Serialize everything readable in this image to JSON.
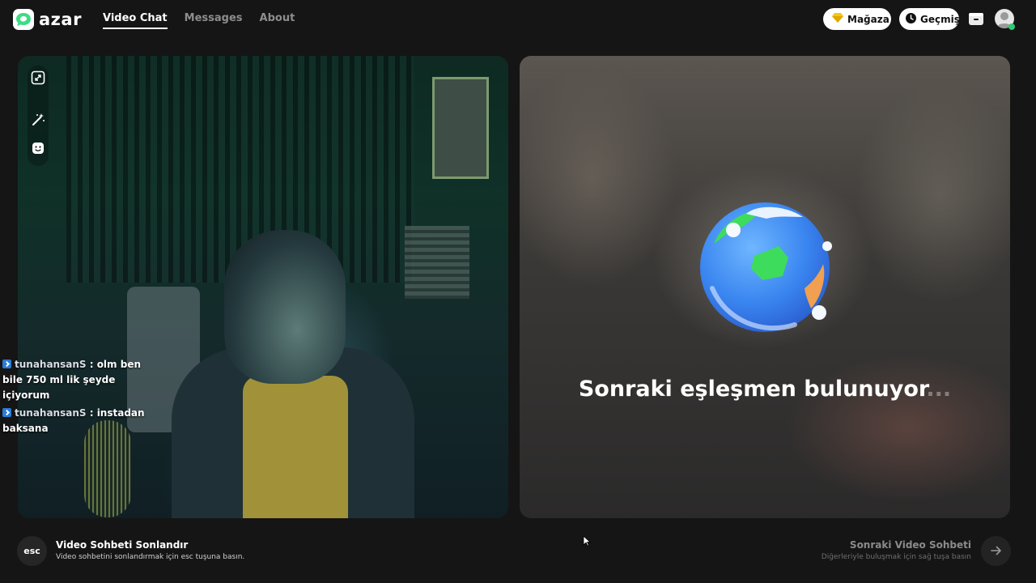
{
  "brand": {
    "name": "azar",
    "logo_icon": "azar-logo-icon"
  },
  "nav": {
    "items": [
      {
        "label": "Video Chat",
        "active": true
      },
      {
        "label": "Messages",
        "active": false
      },
      {
        "label": "About",
        "active": false
      }
    ]
  },
  "header": {
    "shop_label": "Mağaza",
    "shop_icon": "gem-icon",
    "history_label": "Geçmiş",
    "history_icon": "clock-icon",
    "inbox_icon": "inbox-icon",
    "avatar_icon": "user-avatar-icon",
    "avatar_badge_color": "#2ecc71"
  },
  "left_video": {
    "tools": [
      "expand-icon",
      "magic-wand-icon",
      "face-effects-icon"
    ],
    "chat": [
      {
        "user": "tunahansanS",
        "separator": " : ",
        "text": "olm ben bile 750 ml lik şeyde içiyorum"
      },
      {
        "user": "tunahansanS",
        "separator": " : ",
        "text": "instadan baksana"
      }
    ]
  },
  "right_video": {
    "status_text": "Sonraki eşleşmen bulunuyor",
    "status_dots": "...",
    "globe_icon": "globe-icon"
  },
  "footer": {
    "end_key": "esc",
    "end_title": "Video Sohbeti Sonlandır",
    "end_subtitle": "Video sohbetini sonlandırmak için esc tuşuna basın.",
    "next_title": "Sonraki Video Sohbeti",
    "next_subtitle": "Diğerleriyle buluşmak için sağ tuşa basın",
    "next_icon": "arrow-right-icon"
  },
  "colors": {
    "background": "#151515",
    "accent_green": "#3ddc84",
    "nav_inactive": "#8d8d8d"
  }
}
